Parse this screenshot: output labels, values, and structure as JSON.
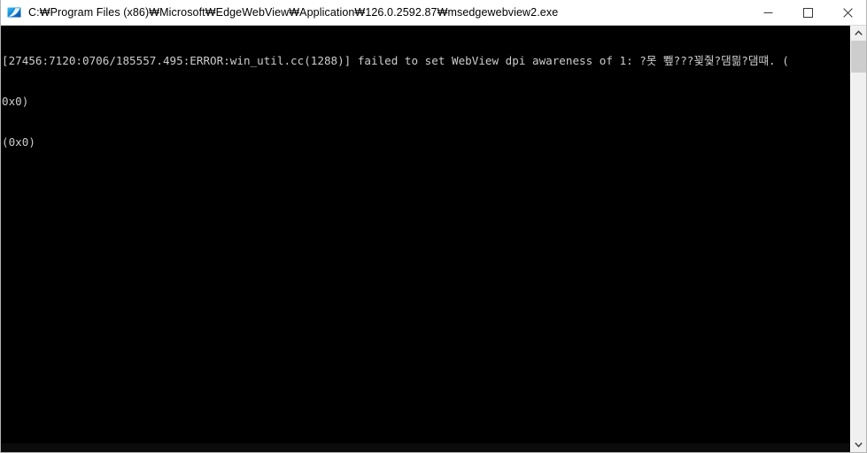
{
  "window": {
    "title": "C:₩Program Files (x86)₩Microsoft₩EdgeWebView₩Application₩126.0.2592.87₩msedgewebview2.exe",
    "icon": "edge-webview2-icon",
    "background_color": "#000000",
    "titlebar_color": "#ffffff",
    "border_color": "#b4b4b4"
  },
  "titlebar_controls": {
    "minimize_label": "—",
    "maximize_label": "☐",
    "close_label": "✕",
    "minimize_name": "Minimize",
    "maximize_name": "Maximize",
    "close_name": "Close"
  },
  "console": {
    "text_color": "#cccccc",
    "lines": [
      "[27456:7120:0706/185557.495:ERROR:win_util.cc(1288)] failed to set WebView dpi awareness of 1: ?못 뾒???uAF97줯?댐믦?댐떄. (",
      "0x0)",
      "(0x0)"
    ],
    "line1": "[27456:7120:0706/185557.495:ERROR:win_util.cc(1288)] failed to set WebView dpi awareness of 1: ?못 뾒???꾗줯?댐믦?댐떄. (",
    "line2": "0x0)",
    "line3": "(0x0)",
    "process_id": "27456",
    "thread_id": "7120",
    "timestamp": "0706/185557.495",
    "severity": "ERROR",
    "source_file": "win_util.cc",
    "source_line": "1288",
    "message": "failed to set WebView dpi awareness of 1",
    "error_code": "0x0"
  },
  "scrollbar": {
    "up_arrow": "⌃",
    "down_arrow": "⌄",
    "thumb_name": "scrollbar-thumb"
  }
}
